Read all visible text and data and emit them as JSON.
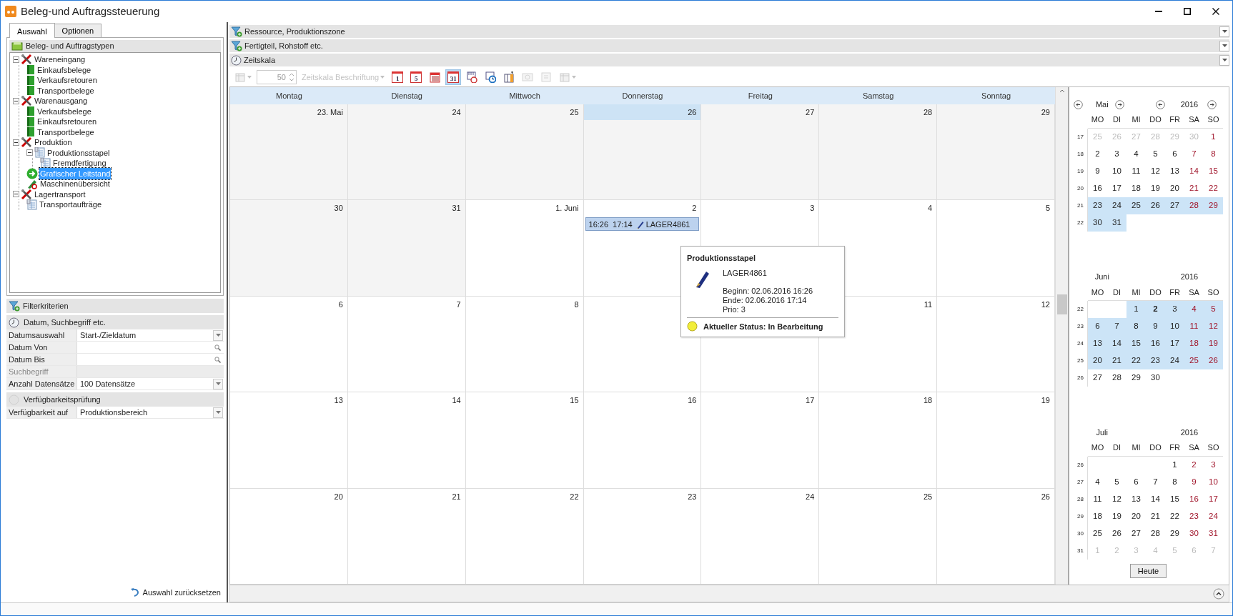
{
  "window": {
    "title": "Beleg-und Auftragssteuerung"
  },
  "left_tabs": [
    {
      "label": "Auswahl",
      "selected": true
    },
    {
      "label": "Optionen",
      "selected": false
    }
  ],
  "tree": {
    "title": "Beleg- und Auftragstypen",
    "items": [
      {
        "label": "Wareneingang",
        "kind": "group",
        "expanded": true,
        "selected": false,
        "children": [
          {
            "label": "Einkaufsbelege",
            "kind": "book",
            "selected": false
          },
          {
            "label": "Verkaufsretouren",
            "kind": "book",
            "selected": false
          },
          {
            "label": "Transportbelege",
            "kind": "book",
            "selected": false
          }
        ]
      },
      {
        "label": "Warenausgang",
        "kind": "group",
        "expanded": true,
        "selected": false,
        "children": [
          {
            "label": "Verkaufsbelege",
            "kind": "book",
            "selected": false
          },
          {
            "label": "Einkaufsretouren",
            "kind": "book",
            "selected": false
          },
          {
            "label": "Transportbelege",
            "kind": "book",
            "selected": false
          }
        ]
      },
      {
        "label": "Produktion",
        "kind": "group",
        "expanded": true,
        "selected": false,
        "children": [
          {
            "label": "Produktionsstapel",
            "kind": "sheet",
            "expanded": true,
            "selected": false,
            "children": [
              {
                "label": "Fremdfertigung",
                "kind": "sheet",
                "selected": false
              }
            ]
          },
          {
            "label": "Grafischer Leitstand",
            "kind": "action",
            "selected": true
          },
          {
            "label": "Maschinenübersicht",
            "kind": "machine",
            "selected": false
          }
        ]
      },
      {
        "label": "Lagertransport",
        "kind": "group",
        "expanded": true,
        "selected": false,
        "children": [
          {
            "label": "Transportaufträge",
            "kind": "sheet",
            "selected": false
          }
        ]
      }
    ]
  },
  "filter": {
    "title": "Filterkriterien",
    "sections": [
      {
        "title": "Datum, Suchbegriff etc.",
        "enabled": true,
        "rows": [
          {
            "label": "Datumsauswahl",
            "value": "Start-/Zieldatum",
            "kind": "dropdown",
            "disabled": false
          },
          {
            "label": "Datum Von",
            "kind": "lookup",
            "disabled": false
          },
          {
            "label": "Datum Bis",
            "kind": "lookup",
            "disabled": false
          },
          {
            "label": "Suchbegriff",
            "kind": "text",
            "disabled": true
          },
          {
            "label": "Anzahl Datensätze",
            "value": "100 Datensätze",
            "kind": "dropdown",
            "disabled": false
          }
        ]
      },
      {
        "title": "Verfügbarkeitsprüfung",
        "enabled": false,
        "rows": [
          {
            "label": "Verfügbarkeit auf",
            "value": "Produktionsbereich",
            "kind": "dropdown",
            "disabled": false
          }
        ]
      }
    ]
  },
  "reset_link": "Auswahl zurücksetzen",
  "group_headers": [
    {
      "title": "Ressource, Produktionszone",
      "kind": "filter"
    },
    {
      "title": "Fertigteil, Rohstoff etc.",
      "kind": "filter"
    },
    {
      "title": "Zeitskala",
      "kind": "clock"
    }
  ],
  "toolbar": [
    {
      "kind": "menu",
      "disabled": true,
      "selected": false
    },
    {
      "kind": "spin",
      "value": "50",
      "disabled": true
    },
    {
      "kind": "dropdown",
      "label": "Zeitskala Beschriftung",
      "disabled": true,
      "selected": false
    },
    {
      "kind": "calendar",
      "label": "1",
      "disabled": false,
      "selected": false
    },
    {
      "kind": "calendar",
      "label": "5",
      "disabled": false,
      "selected": false
    },
    {
      "kind": "month",
      "disabled": false,
      "selected": false
    },
    {
      "kind": "calendar",
      "label": "31",
      "disabled": false,
      "selected": true
    },
    {
      "kind": "timeline",
      "disabled": false,
      "selected": false
    },
    {
      "kind": "clock",
      "disabled": false,
      "selected": false
    },
    {
      "kind": "columns",
      "disabled": false,
      "selected": false
    },
    {
      "kind": "link",
      "disabled": true,
      "selected": false
    },
    {
      "kind": "list",
      "disabled": true,
      "selected": false
    },
    {
      "kind": "menu",
      "disabled": true,
      "selected": false
    }
  ],
  "calendar": {
    "weekdays": [
      "Montag",
      "Dienstag",
      "Mittwoch",
      "Donnerstag",
      "Freitag",
      "Samstag",
      "Sonntag"
    ],
    "weeks": [
      [
        {
          "label": "23. Mai",
          "kind": "other",
          "selected": false
        },
        {
          "label": "24",
          "kind": "other",
          "selected": false
        },
        {
          "label": "25",
          "kind": "other",
          "selected": false
        },
        {
          "label": "26",
          "kind": "other",
          "selected": true
        },
        {
          "label": "27",
          "kind": "other",
          "selected": false
        },
        {
          "label": "28",
          "kind": "other",
          "selected": false
        },
        {
          "label": "29",
          "kind": "other",
          "selected": false
        }
      ],
      [
        {
          "label": "30",
          "kind": "other",
          "selected": false
        },
        {
          "label": "31",
          "kind": "other",
          "selected": false
        },
        {
          "label": "1. Juni",
          "kind": "day",
          "selected": false
        },
        {
          "label": "2",
          "kind": "day",
          "selected": false,
          "appointments": [
            {
              "start": "16:26",
              "end": "17:14",
              "title": "LAGER4861"
            }
          ]
        },
        {
          "label": "3",
          "kind": "day",
          "selected": false
        },
        {
          "label": "4",
          "kind": "day",
          "selected": false
        },
        {
          "label": "5",
          "kind": "day",
          "selected": false
        }
      ],
      [
        {
          "label": "6",
          "kind": "day",
          "selected": false
        },
        {
          "label": "7",
          "kind": "day",
          "selected": false
        },
        {
          "label": "8",
          "kind": "day",
          "selected": false
        },
        {
          "kind": "day"
        },
        {
          "kind": "day"
        },
        {
          "label": "11",
          "kind": "day",
          "selected": false
        },
        {
          "label": "12",
          "kind": "day",
          "selected": false
        }
      ],
      [
        {
          "label": "13",
          "kind": "day",
          "selected": false
        },
        {
          "label": "14",
          "kind": "day",
          "selected": false
        },
        {
          "label": "15",
          "kind": "day",
          "selected": false
        },
        {
          "label": "16",
          "kind": "day",
          "selected": false
        },
        {
          "label": "17",
          "kind": "day",
          "selected": false
        },
        {
          "label": "18",
          "kind": "day",
          "selected": false
        },
        {
          "label": "19",
          "kind": "day",
          "selected": false
        }
      ],
      [
        {
          "label": "20",
          "kind": "day",
          "selected": false
        },
        {
          "label": "21",
          "kind": "day",
          "selected": false
        },
        {
          "label": "22",
          "kind": "day",
          "selected": false
        },
        {
          "label": "23",
          "kind": "day",
          "selected": false
        },
        {
          "label": "24",
          "kind": "day",
          "selected": false
        },
        {
          "label": "25",
          "kind": "day",
          "selected": false
        },
        {
          "label": "26",
          "kind": "day",
          "selected": false
        }
      ]
    ]
  },
  "tooltip": {
    "title": "Produktionsstapel",
    "name": "LAGER4861",
    "details": [
      "Beginn: 02.06.2016 16:26",
      "Ende: 02.06.2016 17:14",
      "Prio: 3"
    ],
    "status": "Aktueller Status: In Bearbeitung"
  },
  "mini_calendar": {
    "months": [
      {
        "month": "Mai",
        "year": "2016",
        "nav": true,
        "weekdays": [
          "MO",
          "DI",
          "MI",
          "DO",
          "FR",
          "SA",
          "SO"
        ],
        "weeks": [
          {
            "week": "17",
            "days": [
              {
                "text": "25",
                "kind": "other",
                "selected": false
              },
              {
                "text": "26",
                "kind": "other",
                "selected": false
              },
              {
                "text": "27",
                "kind": "other",
                "selected": false
              },
              {
                "text": "28",
                "kind": "other",
                "selected": false
              },
              {
                "text": "29",
                "kind": "other",
                "selected": false
              },
              {
                "text": "30",
                "kind": "other",
                "selected": false
              },
              {
                "text": "1",
                "kind": "weekend",
                "selected": false
              }
            ]
          },
          {
            "week": "18",
            "days": [
              {
                "text": "2",
                "kind": "day",
                "selected": false
              },
              {
                "text": "3",
                "kind": "day",
                "selected": false
              },
              {
                "text": "4",
                "kind": "day",
                "selected": false
              },
              {
                "text": "5",
                "kind": "day",
                "selected": false
              },
              {
                "text": "6",
                "kind": "day",
                "selected": false
              },
              {
                "text": "7",
                "kind": "weekend",
                "selected": false
              },
              {
                "text": "8",
                "kind": "weekend",
                "selected": false
              }
            ]
          },
          {
            "week": "19",
            "days": [
              {
                "text": "9",
                "kind": "day",
                "selected": false
              },
              {
                "text": "10",
                "kind": "day",
                "selected": false
              },
              {
                "text": "11",
                "kind": "day",
                "selected": false
              },
              {
                "text": "12",
                "kind": "day",
                "selected": false
              },
              {
                "text": "13",
                "kind": "day",
                "selected": false
              },
              {
                "text": "14",
                "kind": "weekend",
                "selected": false
              },
              {
                "text": "15",
                "kind": "weekend",
                "selected": false
              }
            ]
          },
          {
            "week": "20",
            "days": [
              {
                "text": "16",
                "kind": "day",
                "selected": false
              },
              {
                "text": "17",
                "kind": "day",
                "selected": false
              },
              {
                "text": "18",
                "kind": "day",
                "selected": false
              },
              {
                "text": "19",
                "kind": "day",
                "selected": false
              },
              {
                "text": "20",
                "kind": "day",
                "selected": false
              },
              {
                "text": "21",
                "kind": "weekend",
                "selected": false
              },
              {
                "text": "22",
                "kind": "weekend",
                "selected": false
              }
            ]
          },
          {
            "week": "21",
            "days": [
              {
                "text": "23",
                "kind": "day",
                "selected": true
              },
              {
                "text": "24",
                "kind": "day",
                "selected": true
              },
              {
                "text": "25",
                "kind": "day",
                "selected": true
              },
              {
                "text": "26",
                "kind": "day",
                "selected": true
              },
              {
                "text": "27",
                "kind": "day",
                "selected": true
              },
              {
                "text": "28",
                "kind": "weekend",
                "selected": true
              },
              {
                "text": "29",
                "kind": "weekend",
                "selected": true
              }
            ]
          },
          {
            "week": "22",
            "days": [
              {
                "text": "30",
                "kind": "day",
                "selected": true
              },
              {
                "text": "31",
                "kind": "day",
                "selected": true
              },
              {
                "kind": "blank",
                "selected": false
              },
              {
                "kind": "blank",
                "selected": false
              },
              {
                "kind": "blank",
                "selected": false
              },
              {
                "kind": "blank",
                "selected": false
              },
              {
                "kind": "blank",
                "selected": false
              }
            ]
          }
        ]
      },
      {
        "month": "Juni",
        "year": "2016",
        "nav": false,
        "weekdays": [
          "MO",
          "DI",
          "MI",
          "DO",
          "FR",
          "SA",
          "SO"
        ],
        "weeks": [
          {
            "week": "22",
            "days": [
              {
                "kind": "blank",
                "selected": false
              },
              {
                "kind": "blank",
                "selected": false
              },
              {
                "text": "1",
                "kind": "day",
                "selected": true
              },
              {
                "text": "2",
                "kind": "today",
                "selected": true
              },
              {
                "text": "3",
                "kind": "day",
                "selected": true
              },
              {
                "text": "4",
                "kind": "weekend",
                "selected": true
              },
              {
                "text": "5",
                "kind": "weekend",
                "selected": true
              }
            ]
          },
          {
            "week": "23",
            "days": [
              {
                "text": "6",
                "kind": "day",
                "selected": true
              },
              {
                "text": "7",
                "kind": "day",
                "selected": true
              },
              {
                "text": "8",
                "kind": "day",
                "selected": true
              },
              {
                "text": "9",
                "kind": "day",
                "selected": true
              },
              {
                "text": "10",
                "kind": "day",
                "selected": true
              },
              {
                "text": "11",
                "kind": "weekend",
                "selected": true
              },
              {
                "text": "12",
                "kind": "weekend",
                "selected": true
              }
            ]
          },
          {
            "week": "24",
            "days": [
              {
                "text": "13",
                "kind": "day",
                "selected": true
              },
              {
                "text": "14",
                "kind": "day",
                "selected": true
              },
              {
                "text": "15",
                "kind": "day",
                "selected": true
              },
              {
                "text": "16",
                "kind": "day",
                "selected": true
              },
              {
                "text": "17",
                "kind": "day",
                "selected": true
              },
              {
                "text": "18",
                "kind": "weekend",
                "selected": true
              },
              {
                "text": "19",
                "kind": "weekend",
                "selected": true
              }
            ]
          },
          {
            "week": "25",
            "days": [
              {
                "text": "20",
                "kind": "day",
                "selected": true
              },
              {
                "text": "21",
                "kind": "day",
                "selected": true
              },
              {
                "text": "22",
                "kind": "day",
                "selected": true
              },
              {
                "text": "23",
                "kind": "day",
                "selected": true
              },
              {
                "text": "24",
                "kind": "day",
                "selected": true
              },
              {
                "text": "25",
                "kind": "weekend",
                "selected": true
              },
              {
                "text": "26",
                "kind": "weekend",
                "selected": true
              }
            ]
          },
          {
            "week": "26",
            "days": [
              {
                "text": "27",
                "kind": "day",
                "selected": false
              },
              {
                "text": "28",
                "kind": "day",
                "selected": false
              },
              {
                "text": "29",
                "kind": "day",
                "selected": false
              },
              {
                "text": "30",
                "kind": "day",
                "selected": false
              },
              {
                "kind": "blank",
                "selected": false
              },
              {
                "kind": "blank",
                "selected": false
              },
              {
                "kind": "blank",
                "selected": false
              }
            ]
          }
        ]
      },
      {
        "month": "Juli",
        "year": "2016",
        "nav": false,
        "weekdays": [
          "MO",
          "DI",
          "MI",
          "DO",
          "FR",
          "SA",
          "SO"
        ],
        "weeks": [
          {
            "week": "26",
            "days": [
              {
                "kind": "blank",
                "selected": false
              },
              {
                "kind": "blank",
                "selected": false
              },
              {
                "kind": "blank",
                "selected": false
              },
              {
                "kind": "blank",
                "selected": false
              },
              {
                "text": "1",
                "kind": "day",
                "selected": false
              },
              {
                "text": "2",
                "kind": "weekend",
                "selected": false
              },
              {
                "text": "3",
                "kind": "weekend",
                "selected": false
              }
            ]
          },
          {
            "week": "27",
            "days": [
              {
                "text": "4",
                "kind": "day",
                "selected": false
              },
              {
                "text": "5",
                "kind": "day",
                "selected": false
              },
              {
                "text": "6",
                "kind": "day",
                "selected": false
              },
              {
                "text": "7",
                "kind": "day",
                "selected": false
              },
              {
                "text": "8",
                "kind": "day",
                "selected": false
              },
              {
                "text": "9",
                "kind": "weekend",
                "selected": false
              },
              {
                "text": "10",
                "kind": "weekend",
                "selected": false
              }
            ]
          },
          {
            "week": "28",
            "days": [
              {
                "text": "11",
                "kind": "day",
                "selected": false
              },
              {
                "text": "12",
                "kind": "day",
                "selected": false
              },
              {
                "text": "13",
                "kind": "day",
                "selected": false
              },
              {
                "text": "14",
                "kind": "day",
                "selected": false
              },
              {
                "text": "15",
                "kind": "day",
                "selected": false
              },
              {
                "text": "16",
                "kind": "weekend",
                "selected": false
              },
              {
                "text": "17",
                "kind": "weekend",
                "selected": false
              }
            ]
          },
          {
            "week": "29",
            "days": [
              {
                "text": "18",
                "kind": "day",
                "selected": false
              },
              {
                "text": "19",
                "kind": "day",
                "selected": false
              },
              {
                "text": "20",
                "kind": "day",
                "selected": false
              },
              {
                "text": "21",
                "kind": "day",
                "selected": false
              },
              {
                "text": "22",
                "kind": "day",
                "selected": false
              },
              {
                "text": "23",
                "kind": "weekend",
                "selected": false
              },
              {
                "text": "24",
                "kind": "weekend",
                "selected": false
              }
            ]
          },
          {
            "week": "30",
            "days": [
              {
                "text": "25",
                "kind": "day",
                "selected": false
              },
              {
                "text": "26",
                "kind": "day",
                "selected": false
              },
              {
                "text": "27",
                "kind": "day",
                "selected": false
              },
              {
                "text": "28",
                "kind": "day",
                "selected": false
              },
              {
                "text": "29",
                "kind": "day",
                "selected": false
              },
              {
                "text": "30",
                "kind": "weekend",
                "selected": false
              },
              {
                "text": "31",
                "kind": "weekend",
                "selected": false
              }
            ]
          },
          {
            "week": "31",
            "days": [
              {
                "text": "1",
                "kind": "other",
                "selected": false
              },
              {
                "text": "2",
                "kind": "other",
                "selected": false
              },
              {
                "text": "3",
                "kind": "other",
                "selected": false
              },
              {
                "text": "4",
                "kind": "other",
                "selected": false
              },
              {
                "text": "5",
                "kind": "other",
                "selected": false
              },
              {
                "text": "6",
                "kind": "other",
                "selected": false
              },
              {
                "text": "7",
                "kind": "other",
                "selected": false
              }
            ]
          }
        ]
      }
    ],
    "today_button": "Heute"
  }
}
